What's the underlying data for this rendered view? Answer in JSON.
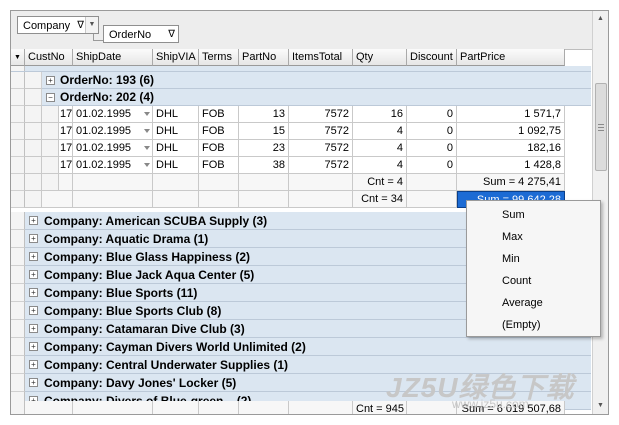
{
  "group_panel": {
    "chips": [
      {
        "label": "Company",
        "filter_glyph": "∇"
      },
      {
        "label": "OrderNo",
        "filter_glyph": "∇"
      }
    ]
  },
  "columns": [
    "CustNo",
    "ShipDate",
    "ShipVIA",
    "Terms",
    "PartNo",
    "ItemsTotal",
    "Qty",
    "Discount",
    "PartPrice"
  ],
  "top_partial_text": "(   )",
  "order_groups": [
    {
      "label": "OrderNo: 193 (6)",
      "expanded": false
    },
    {
      "label": "OrderNo: 202 (4)",
      "expanded": true
    }
  ],
  "rows": [
    {
      "CustNo": "17",
      "ShipDate": "01.02.1995",
      "ShipVIA": "DHL",
      "Terms": "FOB",
      "PartNo": "13",
      "ItemsTotal": "7572",
      "Qty": "16",
      "Discount": "0",
      "PartPrice": "1 571,7"
    },
    {
      "CustNo": "17",
      "ShipDate": "01.02.1995",
      "ShipVIA": "DHL",
      "Terms": "FOB",
      "PartNo": "15",
      "ItemsTotal": "7572",
      "Qty": "4",
      "Discount": "0",
      "PartPrice": "1 092,75"
    },
    {
      "CustNo": "17",
      "ShipDate": "01.02.1995",
      "ShipVIA": "DHL",
      "Terms": "FOB",
      "PartNo": "23",
      "ItemsTotal": "7572",
      "Qty": "4",
      "Discount": "0",
      "PartPrice": "182,16"
    },
    {
      "CustNo": "17",
      "ShipDate": "01.02.1995",
      "ShipVIA": "DHL",
      "Terms": "FOB",
      "PartNo": "38",
      "ItemsTotal": "7572",
      "Qty": "4",
      "Discount": "0",
      "PartPrice": "1 428,8"
    }
  ],
  "order_footer": {
    "qty": "Cnt = 4",
    "price": "Sum = 4 275,41"
  },
  "company_footer": {
    "qty": "Cnt = 34",
    "price": "Sum = 99 642,28"
  },
  "companies": [
    "Company: American SCUBA Supply (3)",
    "Company: Aquatic Drama (1)",
    "Company: Blue Glass Happiness (2)",
    "Company: Blue Jack Aqua Center (5)",
    "Company: Blue Sports (11)",
    "Company: Blue Sports Club (8)",
    "Company: Catamaran Dive Club (3)",
    "Company: Cayman Divers World Unlimited (2)",
    "Company: Central Underwater Supplies (1)",
    "Company: Davy Jones' Locker (5)",
    "Company: Divers of Blue-green... (2)"
  ],
  "grand_footer": {
    "qty": "Cnt = 945",
    "price": "Sum = 6 019 507,68"
  },
  "context_menu": [
    "Sum",
    "Max",
    "Min",
    "Count",
    "Average",
    "(Empty)"
  ],
  "watermark": {
    "main": "JZ5U绿色下载",
    "url": "www.jz5u.com"
  },
  "colors": {
    "group_bg": "#dbe6f1",
    "selected": "#1c6bd4"
  }
}
